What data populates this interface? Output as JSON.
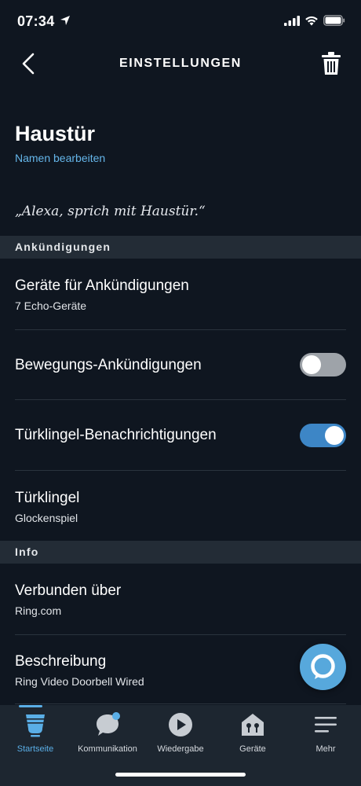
{
  "status_bar": {
    "time": "07:34"
  },
  "header": {
    "title": "EINSTELLUNGEN"
  },
  "device": {
    "name": "Haustür",
    "edit_name_label": "Namen bearbeiten",
    "alexa_phrase": "„Alexa, sprich mit Haustür.“"
  },
  "sections": {
    "announcements": {
      "title": "Ankündigungen",
      "devices_row": {
        "title": "Geräte für Ankündigungen",
        "subtitle": "7 Echo-Geräte"
      },
      "motion_row": {
        "title": "Bewegungs-Ankündigungen",
        "enabled": false
      },
      "doorbell_notifications_row": {
        "title": "Türklingel-Benachrichtigungen",
        "enabled": true
      },
      "doorbell_row": {
        "title": "Türklingel",
        "subtitle": "Glockenspiel"
      }
    },
    "info": {
      "title": "Info",
      "connected_row": {
        "title": "Verbunden über",
        "subtitle": "Ring.com"
      },
      "description_row": {
        "title": "Beschreibung",
        "subtitle": "Ring Video Doorbell Wired"
      }
    }
  },
  "tab_bar": {
    "tabs": [
      {
        "label": "Startseite",
        "icon": "home-icon",
        "active": true
      },
      {
        "label": "Kommunikation",
        "icon": "chat-bubble-icon",
        "active": false
      },
      {
        "label": "Wiedergabe",
        "icon": "play-icon",
        "active": false
      },
      {
        "label": "Geräte",
        "icon": "smart-home-icon",
        "active": false
      },
      {
        "label": "Mehr",
        "icon": "menu-icon",
        "active": false
      }
    ]
  },
  "colors": {
    "background": "#0f1620",
    "section_header": "#232c36",
    "accent": "#65b6ea",
    "toggle_on": "#3d86c6",
    "toggle_off": "#9ea3a9",
    "tab_bar": "#1d2630"
  }
}
